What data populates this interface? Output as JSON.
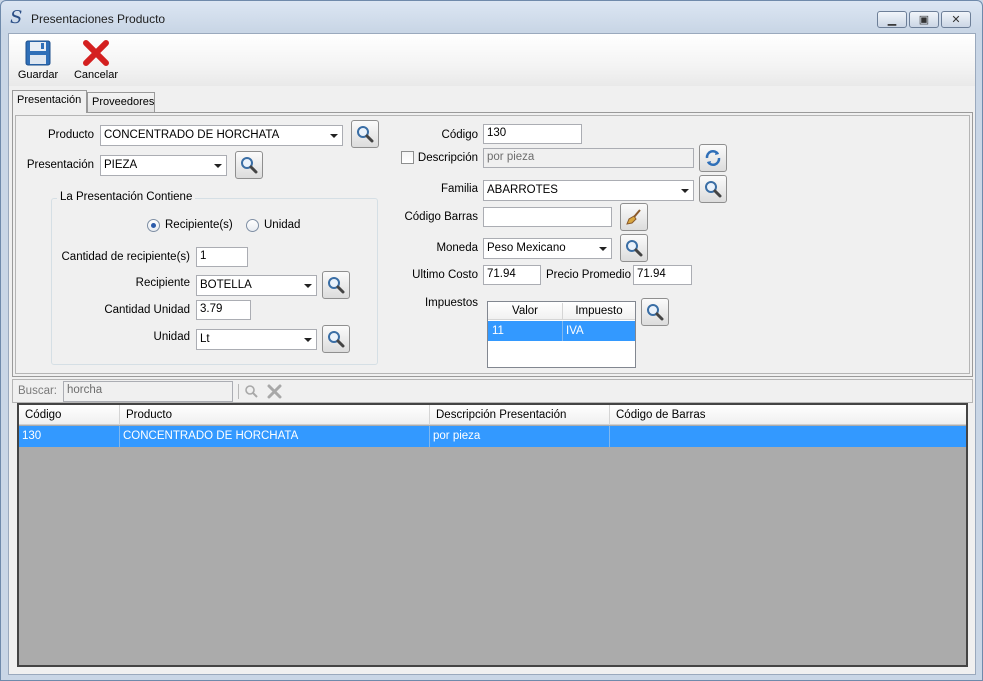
{
  "window": {
    "title": "Presentaciones Producto",
    "app_icon": "S"
  },
  "toolbar": {
    "save_label": "Guardar",
    "cancel_label": "Cancelar"
  },
  "tabs": [
    {
      "label": "Presentación"
    },
    {
      "label": "Proveedores"
    }
  ],
  "form": {
    "producto_label": "Producto",
    "producto_value": "CONCENTRADO DE HORCHATA",
    "presentacion_label": "Presentación",
    "presentacion_value": "PIEZA",
    "group_title": "La Presentación Contiene",
    "radio_recipiente": "Recipiente(s)",
    "radio_unidad": "Unidad",
    "radio_selected": "Recipiente(s)",
    "cant_recip_label": "Cantidad de recipiente(s)",
    "cant_recip_value": "1",
    "recipiente_label": "Recipiente",
    "recipiente_value": "BOTELLA",
    "cant_unidad_label": "Cantidad Unidad",
    "cant_unidad_value": "3.79",
    "unidad_label": "Unidad",
    "unidad_value": "Lt",
    "codigo_label": "Código",
    "codigo_value": "130",
    "descripcion_label": "Descripción",
    "descripcion_value": "por pieza",
    "descripcion_checked": false,
    "familia_label": "Familia",
    "familia_value": "ABARROTES",
    "codbarras_label": "Código Barras",
    "codbarras_value": "",
    "moneda_label": "Moneda",
    "moneda_value": "Peso Mexicano",
    "ultimo_costo_label": "Ultimo Costo",
    "ultimo_costo_value": "71.94",
    "precio_prom_label": "Precio Promedio",
    "precio_prom_value": "71.94",
    "impuestos_label": "Impuestos",
    "taxes": {
      "headers": [
        "Valor",
        "Impuesto"
      ],
      "rows": [
        [
          "11",
          "IVA"
        ]
      ]
    }
  },
  "search": {
    "label": "Buscar:",
    "value": "horcha"
  },
  "grid": {
    "headers": [
      "Código",
      "Producto",
      "Descripción Presentación",
      "Código de Barras"
    ],
    "rows": [
      [
        "130",
        "CONCENTRADO DE HORCHATA",
        "por pieza",
        ""
      ]
    ]
  },
  "colors": {
    "selection": "#3399ff",
    "grid_bg": "#ababab",
    "save_icon": "#2f6fb8",
    "cancel_icon": "#d42020"
  }
}
